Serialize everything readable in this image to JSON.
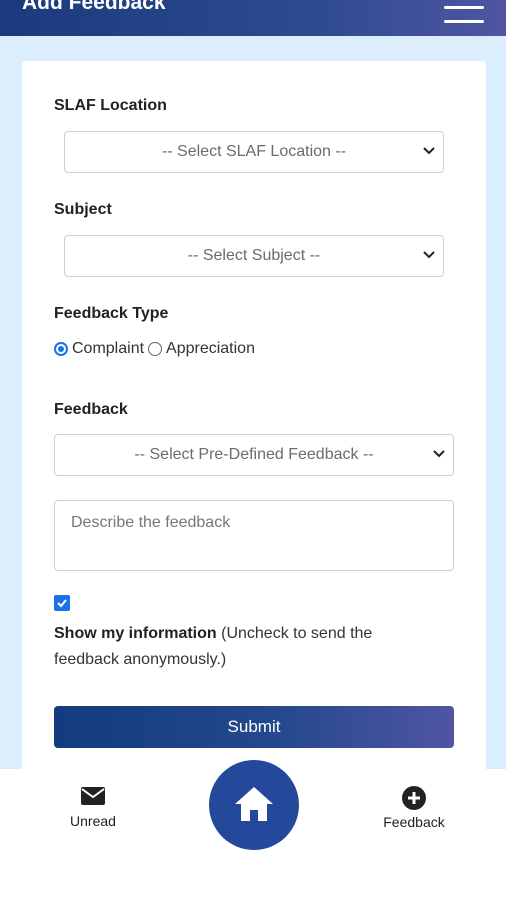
{
  "header": {
    "title": "Add Feedback"
  },
  "form": {
    "location_label": "SLAF Location",
    "location_select": "-- Select SLAF Location --",
    "subject_label": "Subject",
    "subject_select": "-- Select Subject --",
    "type_label": "Feedback Type",
    "type_options": [
      "Complaint",
      "Appreciation"
    ],
    "type_selected": "Complaint",
    "feedback_label": "Feedback",
    "feedback_select": "-- Select Pre-Defined Feedback --",
    "feedback_placeholder": "Describe the feedback",
    "show_info_checked": true,
    "show_info_bold": "Show my information",
    "show_info_note": " (Uncheck to send the feedback anonymously.)",
    "submit_label": "Submit"
  },
  "bottom_nav": {
    "left_label": "Unread",
    "left_icon": "envelope-icon",
    "center_icon": "home-icon",
    "right_label": "Feedback",
    "right_icon": "plus-circle-icon"
  },
  "colors": {
    "brand_dark": "#1b3a7e",
    "brand_light": "#5055a4",
    "background": "#dceefe",
    "accent": "#1a73e8"
  }
}
